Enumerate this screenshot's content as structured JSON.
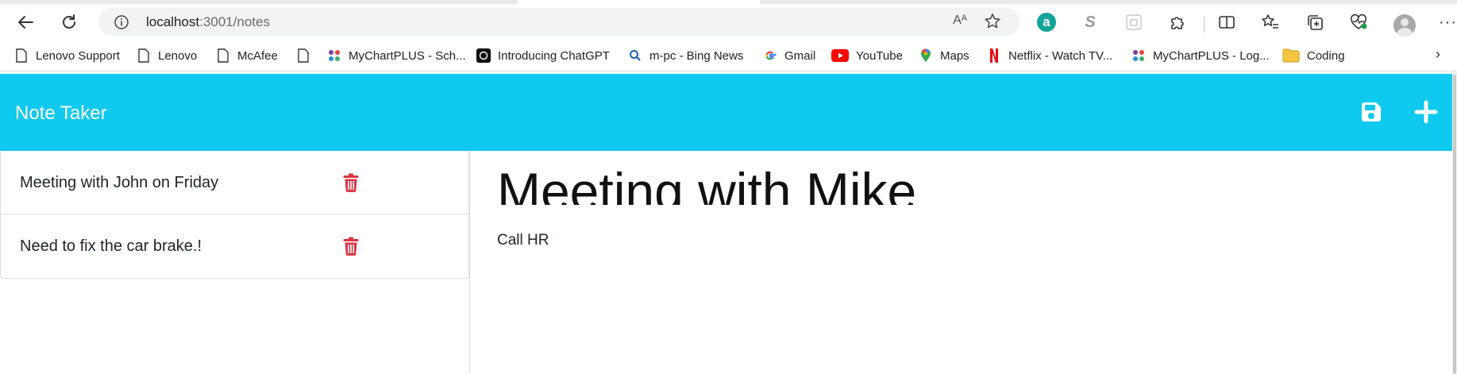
{
  "browser": {
    "url_host": "localhost",
    "url_path": ":3001/notes",
    "read_aloud_label": "Aᴬ",
    "bookmarks": [
      {
        "label": "Lenovo Support",
        "icon": "page-icon"
      },
      {
        "label": "Lenovo",
        "icon": "page-icon"
      },
      {
        "label": "McAfee",
        "icon": "page-icon"
      },
      {
        "label": "",
        "icon": "page-icon"
      },
      {
        "label": "MyChartPLUS - Sch...",
        "icon": "mychart-icon"
      },
      {
        "label": "Introducing ChatGPT",
        "icon": "openai-icon"
      },
      {
        "label": "m-pc - Bing News",
        "icon": "search-icon"
      },
      {
        "label": "Gmail",
        "icon": "google-icon"
      },
      {
        "label": "YouTube",
        "icon": "youtube-icon"
      },
      {
        "label": "Maps",
        "icon": "maps-pin-icon"
      },
      {
        "label": "Netflix - Watch TV...",
        "icon": "netflix-icon"
      },
      {
        "label": "MyChartPLUS - Log...",
        "icon": "mychart-icon"
      },
      {
        "label": "Coding",
        "icon": "folder-icon"
      }
    ],
    "extensions": {
      "a_label": "a",
      "s_label": "S"
    },
    "more_label": "···",
    "bookmarks_chevron": "›"
  },
  "app": {
    "brand": "Note Taker",
    "accent_color": "#10c9ef",
    "delete_color": "#dc3545",
    "notes": [
      {
        "title": "Meeting with John on Friday"
      },
      {
        "title": "Need to fix the car brake.!"
      }
    ],
    "active_note": {
      "title": "Meeting with Mike",
      "text": "Call HR"
    }
  }
}
